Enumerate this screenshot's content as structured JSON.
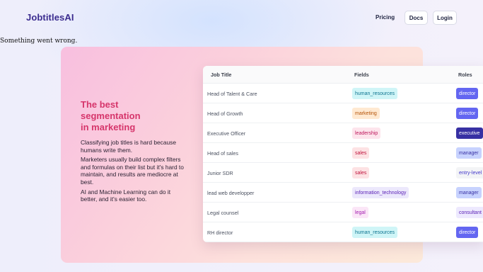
{
  "header": {
    "logo": "JobtitlesAI",
    "nav": {
      "pricing": "Pricing",
      "docs": "Docs",
      "login": "Login"
    }
  },
  "error_message": "Something went wrong.",
  "hero": {
    "title_lines": [
      "The best",
      "segmentation",
      "in marketing"
    ],
    "paragraphs": [
      "Classifying job titles is hard because humans write them.",
      "Marketers usually build complex filters and formulas on their list but it's hard to maintain, and results are mediocre at best.",
      "AI and Machine Learning can do it better, and it's easier too."
    ]
  },
  "table": {
    "columns": [
      "Job Title",
      "Fields",
      "Roles"
    ],
    "rows": [
      {
        "title": "Head of Talent & Care",
        "field": "human_resources",
        "role": "director"
      },
      {
        "title": "Head of Growth",
        "field": "marketing",
        "role": "director"
      },
      {
        "title": "Executive Officer",
        "field": "leadership",
        "role": "executive"
      },
      {
        "title": "Head of sales",
        "field": "sales",
        "role": "manager"
      },
      {
        "title": "Junior SDR",
        "field": "sales",
        "role": "entry-level"
      },
      {
        "title": "lead web developper",
        "field": "information_technology",
        "role": "manager"
      },
      {
        "title": "Legal counsel",
        "field": "legal",
        "role": "consultant"
      },
      {
        "title": "RH director",
        "field": "human_resources",
        "role": "director"
      }
    ]
  },
  "colors": {
    "accent": "#3b2c8f",
    "hero_title": "#d6356b",
    "field_tags": {
      "human_resources": {
        "bg": "#cff5f7",
        "fg": "#0e7490"
      },
      "marketing": {
        "bg": "#ffe9d1",
        "fg": "#b45309"
      },
      "leadership": {
        "bg": "#fde4ec",
        "fg": "#be185d"
      },
      "sales": {
        "bg": "#fde2e4",
        "fg": "#be123c"
      },
      "information_technology": {
        "bg": "#ece8fc",
        "fg": "#5b21b6"
      },
      "legal": {
        "bg": "#fbe6f7",
        "fg": "#a21caf"
      }
    },
    "role_tags": {
      "director": {
        "bg": "#6366f1",
        "fg": "#ffffff"
      },
      "executive": {
        "bg": "#3730a3",
        "fg": "#ffffff"
      },
      "manager": {
        "bg": "#c7d2fe",
        "fg": "#3730a3"
      },
      "entry-level": {
        "bg": "#f3f4f6",
        "fg": "#4338ca"
      },
      "consultant": {
        "bg": "#ede9fe",
        "fg": "#5b21b6"
      }
    }
  }
}
